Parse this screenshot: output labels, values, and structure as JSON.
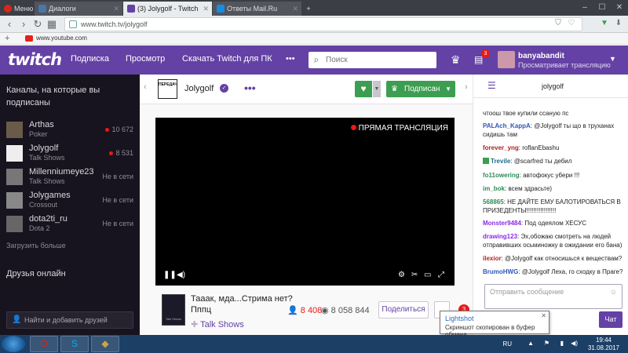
{
  "browser": {
    "tabs": [
      {
        "label": "Меню",
        "color": "#3b3f45"
      },
      {
        "label": "Диалоги",
        "color": "#4a76a8"
      },
      {
        "label": "(3) Jolygolf - Twitch",
        "color": "#6441a4"
      },
      {
        "label": "Ответы Mail.Ru",
        "color": "#168de2"
      }
    ],
    "url_domain": "www.twitch.tv/",
    "url_path": "jolygolf",
    "bookmark": "www.youtube.com"
  },
  "header": {
    "logo": "twitch",
    "nav": [
      "Подписка",
      "Просмотр",
      "Скачать Twitch для ПК",
      "•••"
    ],
    "search_placeholder": "Поиск",
    "notif_count": "3",
    "user_name": "banyabandit",
    "user_status": "Просматривает трансляцию"
  },
  "sidebar": {
    "heading": "Каналы, на которые вы подписаны",
    "channels": [
      {
        "name": "Arthas",
        "game": "Poker",
        "viewers": "10 672",
        "live": true
      },
      {
        "name": "Jolygolf",
        "game": "Talk Shows",
        "viewers": "8 531",
        "live": true
      },
      {
        "name": "Millenniumeye23",
        "game": "Talk Shows",
        "viewers": "Не в сети",
        "live": false
      },
      {
        "name": "Jolygames",
        "game": "Crossout",
        "viewers": "Не в сети",
        "live": false
      },
      {
        "name": "dota2ti_ru",
        "game": "Dota 2",
        "viewers": "Не в сети",
        "live": false
      }
    ],
    "load_more": "Загрузить больше",
    "friends_heading": "Друзья онлайн",
    "friends_search": "Найти и добавить друзей"
  },
  "channel": {
    "name": "Jolygolf",
    "logo_text": "ПЕРЕДАЧА",
    "subscribed_label": "Подписан",
    "live_label": "ПРЯМАЯ ТРАНСЛЯЦИЯ",
    "title": "Тааак, мда...Стрима нет? Пппц",
    "game": "Talk Shows",
    "viewers": "8 408",
    "views": "8 058 844",
    "share_label": "Поделиться",
    "badge": "3"
  },
  "chat": {
    "channel": "jolygolf",
    "messages": [
      {
        "user": "",
        "text": "чтоош твое купили ссаную пс",
        "color": "#222"
      },
      {
        "user": "PALAch_KappA",
        "text": "@Jolygolf ты що в труханах сидишь там",
        "color": "#2e57b8"
      },
      {
        "user": "forever_yng",
        "text": "roflanEbashu",
        "color": "#b22222"
      },
      {
        "user": "Trevile",
        "text": "@scarfred ты дебил",
        "color": "#1e6b8a",
        "badge": true
      },
      {
        "user": "fo11owering",
        "text": "автофокус убери !!!",
        "color": "#2e8b57"
      },
      {
        "user": "im_bok",
        "text": "всем здрасьте)",
        "color": "#2e8b57"
      },
      {
        "user": "568865",
        "text": "НЕ ДАЙТЕ ЕМУ БАЛОТИРОВАТЬСЯ В ПРИЗЕДЕНТЫ!!!!!!!!!!!!!!!!!",
        "color": "#2e8b57"
      },
      {
        "user": "Monster9484",
        "text": "Под одеялом ХЕСУС",
        "color": "#8a2be2"
      },
      {
        "user": "drawing123",
        "text": "Эх,обожаю смотреть на людей отправивших осьминожку в ожидании его бана)",
        "color": "#8a2be2"
      },
      {
        "user": "ilexior",
        "text": "@Jolygolf как относишься к веществам?",
        "color": "#b22222"
      },
      {
        "user": "BrumoHWG",
        "text": "@Jolygolf Леха, го сходку в Праге?",
        "color": "#2e57b8"
      }
    ],
    "input_placeholder": "Отправить сообщение",
    "send_label": "Чат"
  },
  "lightshot": {
    "title": "Lightshot",
    "text": "Скриншот скопирован в буфер обмена"
  },
  "taskbar": {
    "lang": "RU",
    "time": "19:44",
    "date": "31.08.2017"
  }
}
